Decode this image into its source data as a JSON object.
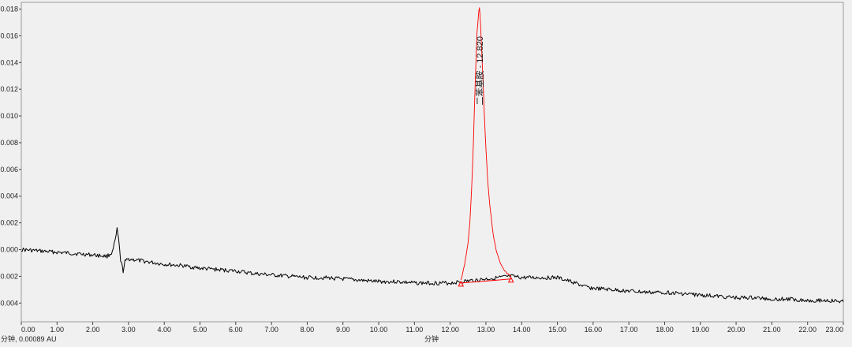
{
  "chart_data": {
    "type": "line",
    "xlabel": "分钟",
    "ylabel": "",
    "xlim": [
      0.0,
      23.0
    ],
    "ylim": [
      -0.0054,
      0.0185
    ],
    "x_ticks": [
      "0.00",
      "1.00",
      "2.00",
      "3.00",
      "4.00",
      "5.00",
      "6.00",
      "7.00",
      "8.00",
      "9.00",
      "10.00",
      "11.00",
      "12.00",
      "13.00",
      "14.00",
      "15.00",
      "16.00",
      "17.00",
      "18.00",
      "19.00",
      "20.00",
      "21.00",
      "22.00",
      "23.00"
    ],
    "x_tick_values": [
      0,
      1,
      2,
      3,
      4,
      5,
      6,
      7,
      8,
      9,
      10,
      11,
      12,
      13,
      14,
      15,
      16,
      17,
      18,
      19,
      20,
      21,
      22,
      23
    ],
    "y_ticks": [
      "-0.004",
      "-0.002",
      "0.000",
      "0.002",
      "0.004",
      "0.006",
      "0.008",
      "0.010",
      "0.012",
      "0.014",
      "0.016",
      "0.018"
    ],
    "y_tick_values": [
      -0.004,
      -0.002,
      0.0,
      0.002,
      0.004,
      0.006,
      0.008,
      0.01,
      0.012,
      0.014,
      0.016,
      0.018
    ],
    "grid": false,
    "cursor_readout": "分钟, 0.00089 AU",
    "peak_annotation": "二苯基胺 - 12.820",
    "series": [
      {
        "color": "#000000",
        "x": [
          0.0,
          0.5,
          1.0,
          1.5,
          2.0,
          2.4,
          2.55,
          2.62,
          2.68,
          2.72,
          2.78,
          2.85,
          2.9,
          3.0,
          3.5,
          4.0,
          4.5,
          5.0,
          5.5,
          6.0,
          6.5,
          7.0,
          7.5,
          8.0,
          8.5,
          9.0,
          9.5,
          10.0,
          10.5,
          11.0,
          11.5,
          12.0,
          12.3,
          13.7,
          14.0,
          14.5,
          15.0,
          15.5,
          15.8,
          16.0,
          16.5,
          17.0,
          17.5,
          18.0,
          18.5,
          19.0,
          19.5,
          20.0,
          20.5,
          21.0,
          21.5,
          22.0,
          22.5,
          23.0
        ],
        "y": [
          0.0,
          -0.0001,
          -0.0002,
          -0.0003,
          -0.0004,
          -0.0005,
          -0.0002,
          0.0006,
          0.0015,
          0.0008,
          -0.0008,
          -0.0016,
          -0.0009,
          -0.0007,
          -0.0009,
          -0.0011,
          -0.0012,
          -0.0014,
          -0.0015,
          -0.0016,
          -0.0018,
          -0.0019,
          -0.002,
          -0.0021,
          -0.0021,
          -0.0022,
          -0.0023,
          -0.0024,
          -0.0024,
          -0.0025,
          -0.0025,
          -0.0025,
          -0.0024,
          -0.002,
          -0.0021,
          -0.0021,
          -0.0021,
          -0.0025,
          -0.0028,
          -0.0029,
          -0.003,
          -0.0031,
          -0.0032,
          -0.0032,
          -0.0033,
          -0.0034,
          -0.0035,
          -0.0036,
          -0.0036,
          -0.0037,
          -0.0037,
          -0.0038,
          -0.0038,
          -0.0039
        ]
      },
      {
        "color": "#ff0000",
        "x": [
          12.3,
          12.4,
          12.5,
          12.55,
          12.6,
          12.65,
          12.7,
          12.75,
          12.8,
          12.82,
          12.85,
          12.9,
          12.95,
          13.0,
          13.05,
          13.1,
          13.2,
          13.3,
          13.4,
          13.5,
          13.6,
          13.7
        ],
        "y": [
          -0.0023,
          -0.0012,
          0.0005,
          0.002,
          0.0045,
          0.008,
          0.0125,
          0.0162,
          0.0178,
          0.0181,
          0.0168,
          0.0138,
          0.0105,
          0.0075,
          0.0052,
          0.0035,
          0.0012,
          -0.0002,
          -0.001,
          -0.0015,
          -0.0018,
          -0.002
        ]
      }
    ],
    "integration_baseline": {
      "color": "#ff0000",
      "x": [
        12.3,
        13.7
      ],
      "y": [
        -0.0025,
        -0.0022
      ]
    }
  }
}
